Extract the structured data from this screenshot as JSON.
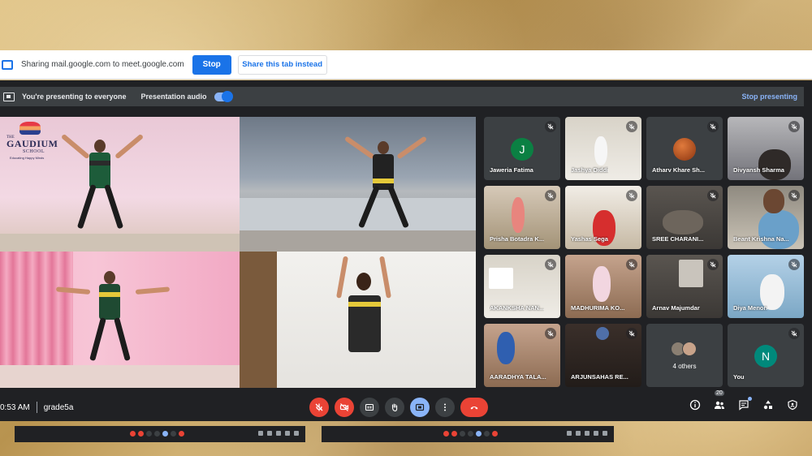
{
  "share_bar": {
    "text": "Sharing mail.google.com to meet.google.com",
    "stop_label": "Stop",
    "share_tab_label": "Share this tab instead"
  },
  "presenting_bar": {
    "status": "You're presenting to everyone",
    "audio_label": "Presentation audio",
    "audio_on": true,
    "stop_label": "Stop presenting"
  },
  "stage": {
    "logo": {
      "the": "THE",
      "name": "GAUDIUM",
      "sub": "SCHOOL",
      "tagline": "Educating Happy Minds"
    }
  },
  "participants": [
    {
      "name": "Jaweria Fatima",
      "avatar_letter": "J",
      "avatar_color": "#0b8043",
      "muted": true
    },
    {
      "name": "Jashya Diddi",
      "muted": true
    },
    {
      "name": "Atharv Khare Sh...",
      "muted": true
    },
    {
      "name": "Divyansh Sharma",
      "muted": true
    },
    {
      "name": "Prisha Botadra K...",
      "muted": true
    },
    {
      "name": "Yashas Sega",
      "muted": true
    },
    {
      "name": "SREE CHARANI...",
      "muted": true
    },
    {
      "name": "Beant Krishna Na...",
      "muted": true
    },
    {
      "name": "AKANKSHA NAN...",
      "muted": true
    },
    {
      "name": "MADHURIMA KO...",
      "muted": true
    },
    {
      "name": "Arnav Majumdar",
      "muted": true
    },
    {
      "name": "Diya Menon",
      "muted": true
    },
    {
      "name": "AARADHYA TALA...",
      "muted": true
    },
    {
      "name": "ARJUNSAHAS RE...",
      "muted": true
    },
    {
      "name": "4 others"
    },
    {
      "name": "You",
      "avatar_letter": "N",
      "avatar_color": "#00897b",
      "muted": true
    }
  ],
  "controls": {
    "time": "0:53 AM",
    "meeting_code": "grade5a",
    "people_count": "20"
  },
  "colors": {
    "accent": "#1a73e8",
    "danger": "#ea4335",
    "surface": "#202124",
    "tile": "#3c4043"
  }
}
